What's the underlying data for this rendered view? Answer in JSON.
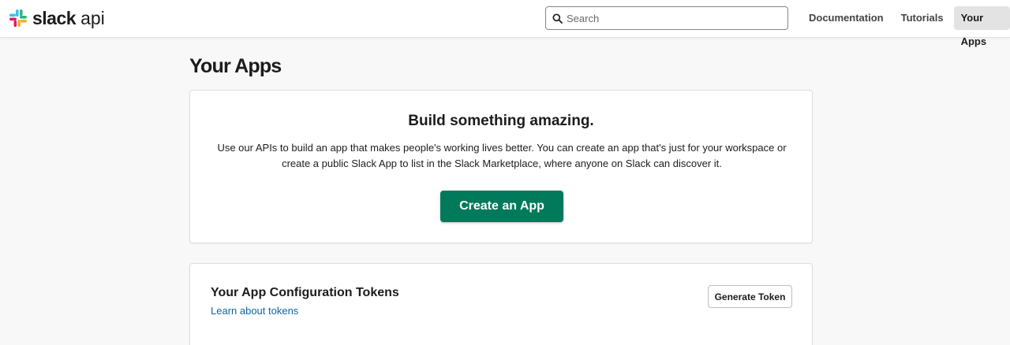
{
  "header": {
    "logo_text": "slack",
    "logo_suffix": "api",
    "search": {
      "placeholder": "Search",
      "value": ""
    },
    "nav": [
      {
        "label": "Documentation"
      },
      {
        "label": "Tutorials"
      },
      {
        "label": "Your Apps",
        "active": true
      }
    ]
  },
  "main": {
    "title": "Your Apps",
    "hero": {
      "heading": "Build something amazing.",
      "text": "Use our APIs to build an app that makes people's working lives better. You can create an app that's just for your workspace or create a public Slack App to list in the Slack Marketplace, where anyone on Slack can discover it.",
      "button_label": "Create an App"
    },
    "tokens": {
      "title": "Your App Configuration Tokens",
      "link_label": "Learn about tokens",
      "button_label": "Generate Token"
    }
  },
  "colors": {
    "primary_button": "#007a5a",
    "link": "#1264a3",
    "background": "#f8f8f8"
  },
  "icons": {
    "logo": "slack-logo-icon",
    "search": "search-icon"
  }
}
